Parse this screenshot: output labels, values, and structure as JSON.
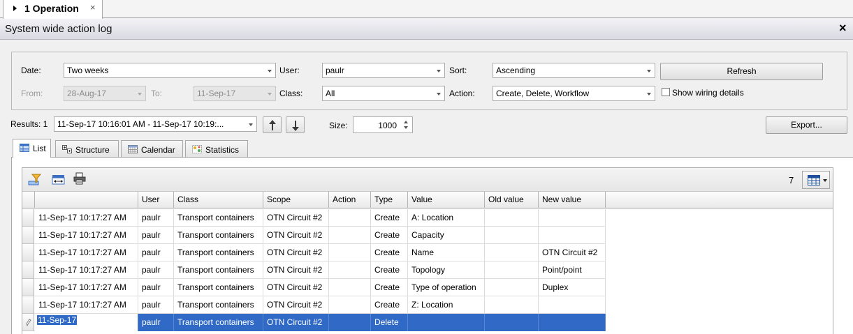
{
  "doc_tab": {
    "label": "1 Operation",
    "close": "×"
  },
  "window": {
    "title": "System wide action log",
    "close": "×"
  },
  "filters": {
    "date_label": "Date:",
    "date_value": "Two weeks",
    "user_label": "User:",
    "user_value": "paulr",
    "sort_label": "Sort:",
    "sort_value": "Ascending",
    "refresh_label": "Refresh",
    "from_label": "From:",
    "from_value": "28-Aug-17",
    "to_label": "To:",
    "to_value": "11-Sep-17",
    "class_label": "Class:",
    "class_value": "All",
    "action_label": "Action:",
    "action_value": "Create, Delete, Workflow",
    "show_wiring_label": "Show wiring details"
  },
  "results": {
    "label": "Results: 1",
    "range_value": "11-Sep-17 10:16:01 AM - 11-Sep-17 10:19:...",
    "size_label": "Size:",
    "size_value": "1000",
    "export_label": "Export..."
  },
  "tabs": [
    {
      "label": "List",
      "active": true
    },
    {
      "label": "Structure",
      "active": false
    },
    {
      "label": "Calendar",
      "active": false
    },
    {
      "label": "Statistics",
      "active": false
    }
  ],
  "grid": {
    "count": "7",
    "columns": [
      "",
      "User",
      "Class",
      "Scope",
      "Action",
      "Type",
      "Value",
      "Old value",
      "New value"
    ],
    "rows": [
      {
        "time": "11-Sep-17 10:17:27 AM",
        "user": "paulr",
        "class": "Transport containers",
        "scope": "OTN Circuit #2",
        "action": "",
        "type": "Create",
        "value": "A: Location",
        "old": "",
        "new": ""
      },
      {
        "time": "11-Sep-17 10:17:27 AM",
        "user": "paulr",
        "class": "Transport containers",
        "scope": "OTN Circuit #2",
        "action": "",
        "type": "Create",
        "value": "Capacity",
        "old": "",
        "new": ""
      },
      {
        "time": "11-Sep-17 10:17:27 AM",
        "user": "paulr",
        "class": "Transport containers",
        "scope": "OTN Circuit #2",
        "action": "",
        "type": "Create",
        "value": "Name",
        "old": "",
        "new": "OTN Circuit #2"
      },
      {
        "time": "11-Sep-17 10:17:27 AM",
        "user": "paulr",
        "class": "Transport containers",
        "scope": "OTN Circuit #2",
        "action": "",
        "type": "Create",
        "value": "Topology",
        "old": "",
        "new": "Point/point"
      },
      {
        "time": "11-Sep-17 10:17:27 AM",
        "user": "paulr",
        "class": "Transport containers",
        "scope": "OTN Circuit #2",
        "action": "",
        "type": "Create",
        "value": "Type of operation",
        "old": "",
        "new": "Duplex"
      },
      {
        "time": "11-Sep-17 10:17:27 AM",
        "user": "paulr",
        "class": "Transport containers",
        "scope": "OTN Circuit #2",
        "action": "",
        "type": "Create",
        "value": "Z: Location",
        "old": "",
        "new": ""
      },
      {
        "time": "11-Sep-17",
        "user": "paulr",
        "class": "Transport containers",
        "scope": "OTN Circuit #2",
        "action": "",
        "type": "Delete",
        "value": "",
        "old": "",
        "new": "",
        "selected": true
      }
    ]
  },
  "colors": {
    "selection": "#3069c6"
  }
}
